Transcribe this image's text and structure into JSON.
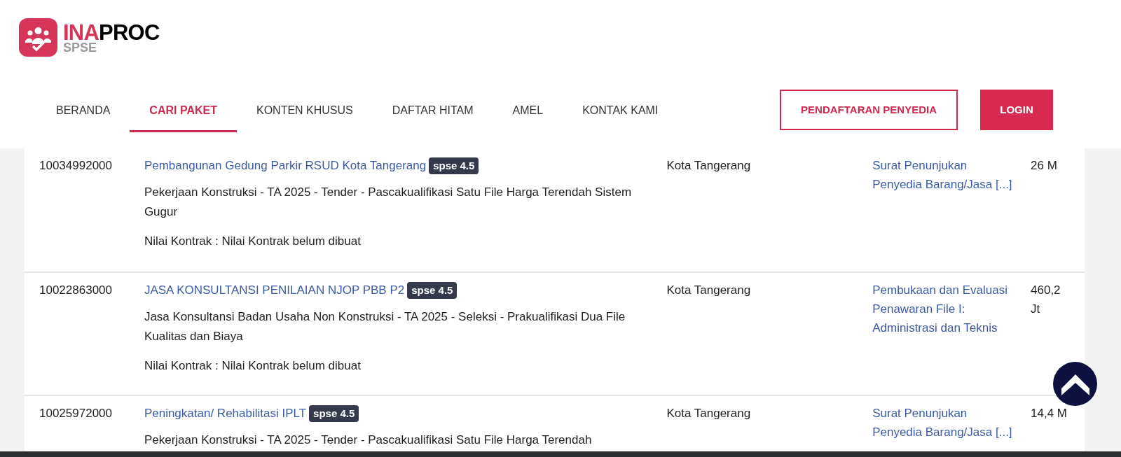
{
  "logo": {
    "brand_part_1": "INA",
    "brand_part_2": "PROC",
    "subtitle": "SPSE"
  },
  "nav": [
    {
      "label": "BERANDA",
      "selected": false
    },
    {
      "label": "CARI PAKET",
      "selected": true
    },
    {
      "label": "KONTEN KHUSUS",
      "selected": false
    },
    {
      "label": "DAFTAR HITAM",
      "selected": false
    },
    {
      "label": "AMEL",
      "selected": false
    },
    {
      "label": "KONTAK KAMI",
      "selected": false
    }
  ],
  "buttons": [
    {
      "label": "PENDAFTARAN PENYEDIA",
      "kind": "outline"
    },
    {
      "label": "LOGIN",
      "kind": "filled"
    }
  ],
  "rows": [
    {
      "code": "10034992000",
      "title": "Pembangunan Gedung Parkir RSUD Kota Tangerang",
      "badge": "spse 4.5",
      "details": "Pekerjaan Konstruksi - TA 2025 - Tender - Pascakualifikasi Satu File Harga Terendah Sistem Gugur",
      "contract": "Nilai Kontrak : Nilai Kontrak belum dibuat",
      "location": "Kota Tangerang",
      "stage": "Surat Penunjukan Penyedia Barang/Jasa [...]",
      "value": "26 M"
    },
    {
      "code": "10022863000",
      "title": "JASA KONSULTANSI PENILAIAN NJOP PBB P2",
      "badge": "spse 4.5",
      "details": "Jasa Konsultansi Badan Usaha Non Konstruksi - TA 2025 - Seleksi - Prakualifikasi Dua File Kualitas dan Biaya",
      "contract": "Nilai Kontrak : Nilai Kontrak belum dibuat",
      "location": "Kota Tangerang",
      "stage": "Pembukaan dan Evaluasi Penawaran File I: Administrasi dan Teknis",
      "value": "460,2 Jt"
    },
    {
      "code": "10025972000",
      "title": "Peningkatan/ Rehabilitasi IPLT",
      "badge": "spse 4.5",
      "details": "Pekerjaan Konstruksi - TA 2025 - Tender - Pascakualifikasi Satu File Harga Terendah",
      "location": "Kota Tangerang",
      "stage": "Surat Penunjukan Penyedia Barang/Jasa [...]",
      "value": "14,4 M"
    }
  ]
}
